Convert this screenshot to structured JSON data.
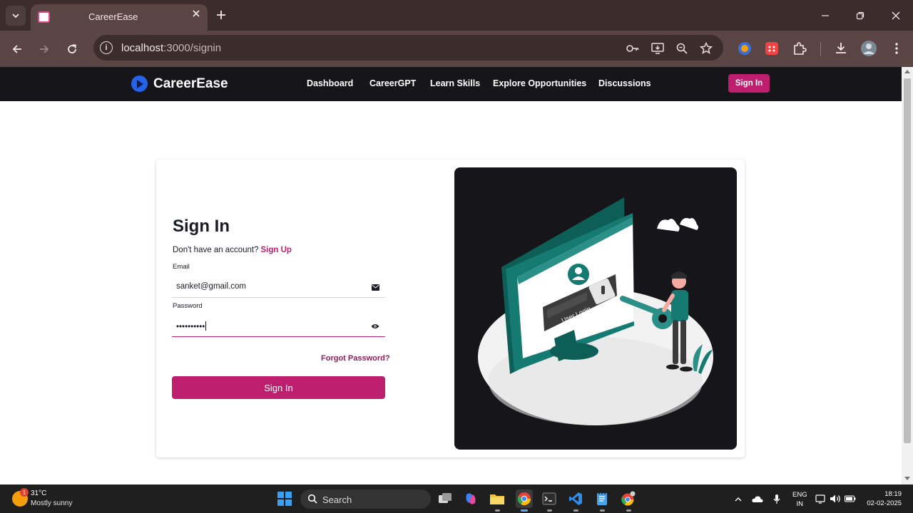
{
  "browser": {
    "tab_title": "CareerEase",
    "url_host": "localhost",
    "url_path": ":3000/signin"
  },
  "app": {
    "brand": "CareerEase",
    "nav": [
      "Dashboard",
      "CareerGPT",
      "Learn Skills",
      "Explore Opportunities",
      "Discussions"
    ],
    "nav_signin": "Sign In",
    "accent_color": "#be1e6e"
  },
  "form": {
    "title": "Sign In",
    "prompt": "Don't have an account?",
    "signup_link": "Sign Up",
    "email_label": "Email",
    "email_value": "sanket@gmail.com",
    "password_label": "Password",
    "password_value": "••••••••••",
    "forgot": "Forgot Password?",
    "submit": "Sign In"
  },
  "illustration": {
    "screen_text": "User Login"
  },
  "taskbar": {
    "temperature": "31°C",
    "weather": "Mostly sunny",
    "weather_badge": "1",
    "search": "Search",
    "lang_top": "ENG",
    "lang_bottom": "IN",
    "time": "18:19",
    "date": "02-02-2025"
  }
}
